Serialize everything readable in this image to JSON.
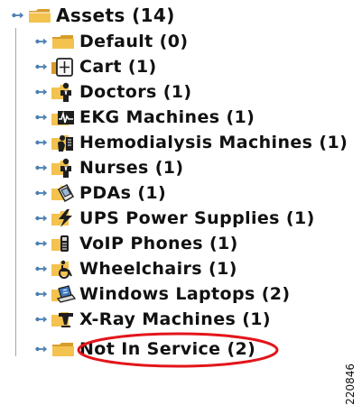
{
  "tree": {
    "root": {
      "label": "Assets (14)"
    },
    "items": [
      {
        "label": "Default (0)",
        "icon": "folder-icon"
      },
      {
        "label": "Cart (1)",
        "icon": "cart-icon"
      },
      {
        "label": "Doctors (1)",
        "icon": "doctor-icon"
      },
      {
        "label": "EKG Machines (1)",
        "icon": "ekg-machine-icon"
      },
      {
        "label": "Hemodialysis Machines (1)",
        "icon": "hemodialysis-machine-icon"
      },
      {
        "label": "Nurses (1)",
        "icon": "nurse-icon"
      },
      {
        "label": "PDAs (1)",
        "icon": "pda-icon"
      },
      {
        "label": "UPS Power Supplies (1)",
        "icon": "ups-power-supply-icon"
      },
      {
        "label": "VoIP Phones (1)",
        "icon": "voip-phone-icon"
      },
      {
        "label": "Wheelchairs (1)",
        "icon": "wheelchair-icon"
      },
      {
        "label": "Windows Laptops (2)",
        "icon": "windows-laptop-icon"
      },
      {
        "label": "X-Ray Machines (1)",
        "icon": "x-ray-machine-icon"
      },
      {
        "label": "Not In Service (2)",
        "icon": "folder-icon"
      }
    ]
  },
  "annotation": {
    "highlight_color": "#e3151b",
    "highlighted_item": "Not In Service (2)"
  },
  "figure_id": "220846",
  "colors": {
    "folder": "#f3c24f",
    "folder_dark": "#d89c2a",
    "expander": "#4c7fb3"
  }
}
